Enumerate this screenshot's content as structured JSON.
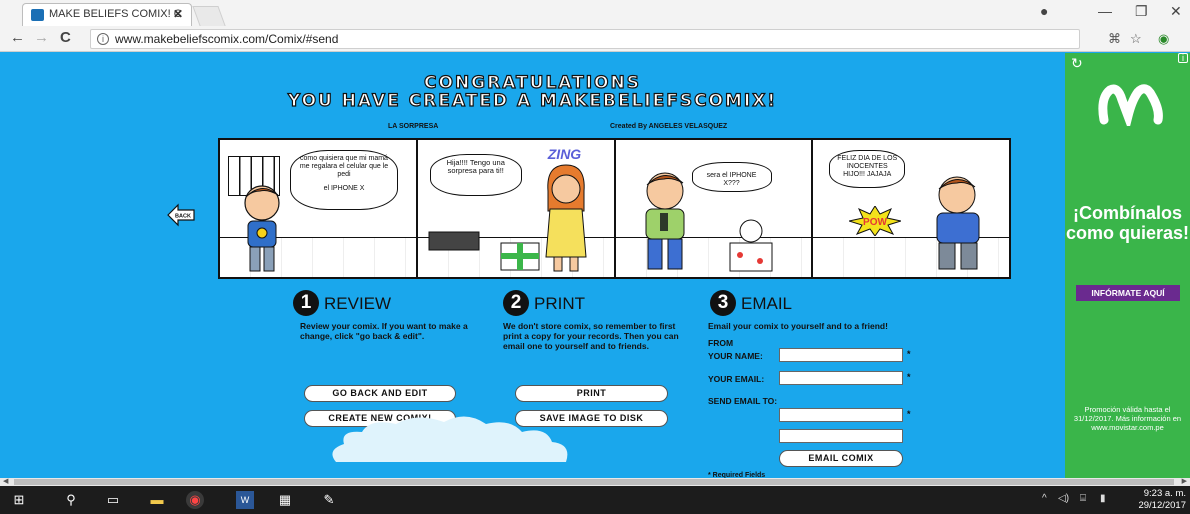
{
  "browser": {
    "tab_title": "MAKE BELIEFS COMIX! C",
    "tab_close": "✕",
    "url": "www.makebeliefscomix.com/Comix/#send",
    "back": "←",
    "forward": "→",
    "reload": "C",
    "minimize": "—",
    "restore": "❐",
    "close": "✕"
  },
  "page": {
    "congrats_line1": "CONGRATULATIONS",
    "congrats_line2": "YOU HAVE CREATED A MAKEBELIEFSCOMIX!",
    "comic_title": "LA SORPRESA",
    "created_by": "Created By ANGELES VELASQUEZ",
    "back_label": "BACK",
    "panels": [
      {
        "bubble": "como quisiera que mi mamá me regalara el celular que le pedi",
        "bubble2": "el IPHONE X"
      },
      {
        "bubble": "Hija!!!! Tengo una sorpresa para ti!!",
        "sfx": "ZING"
      },
      {
        "bubble": "sera el IPHONE X???"
      },
      {
        "bubble": "FELIZ DIA DE LOS INOCENTES HIJO!!! JAJAJA",
        "sfx": "POW"
      }
    ]
  },
  "steps": {
    "review": {
      "num": "1",
      "title": "REVIEW",
      "desc": "Review your comix. If you want to make a change, click \"go back & edit\".",
      "btn_edit": "GO BACK AND EDIT",
      "btn_new": "CREATE NEW COMIX!"
    },
    "print": {
      "num": "2",
      "title": "PRINT",
      "desc": "We don't store comix, so remember to first print a copy for your records. Then you can email one to yourself and to friends.",
      "btn_print": "PRINT",
      "btn_save": "SAVE IMAGE TO DISK"
    },
    "email": {
      "num": "3",
      "title": "EMAIL",
      "desc": "Email your comix to yourself and to a friend!",
      "from": "FROM",
      "your_name": "YOUR NAME:",
      "your_email": "YOUR EMAIL:",
      "send_to": "SEND EMAIL TO:",
      "required_mark": "*",
      "btn_email": "EMAIL COMIX",
      "required_note": "* Required Fields"
    }
  },
  "ad": {
    "headline": "¡Combínalos como quieras!",
    "cta": "INFÓRMATE AQUÍ",
    "fine_print": "Promoción válida hasta el 31/12/2017. Más información en www.movistar.com.pe",
    "brand_color": "#3ab54a"
  },
  "taskbar": {
    "time": "9:23 a. m.",
    "date": "29/12/2017"
  }
}
